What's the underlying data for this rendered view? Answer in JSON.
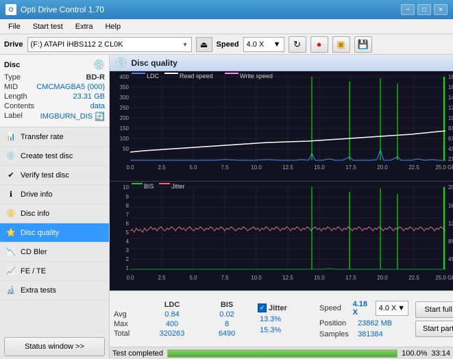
{
  "titleBar": {
    "title": "Opti Drive Control 1.70",
    "minimize": "−",
    "maximize": "□",
    "close": "×"
  },
  "menuBar": {
    "items": [
      "File",
      "Start test",
      "Extra",
      "Help"
    ]
  },
  "driveBar": {
    "label": "Drive",
    "driveValue": "(F:) ATAPI iHBS112  2 CL0K",
    "speedLabel": "Speed",
    "speedValue": "4.0 X"
  },
  "disc": {
    "sectionLabel": "Disc",
    "typeLabel": "Type",
    "typeValue": "BD-R",
    "midLabel": "MID",
    "midValue": "CMCMAGBA5 (000)",
    "lengthLabel": "Length",
    "lengthValue": "23.31 GB",
    "contentsLabel": "Contents",
    "contentsValue": "data",
    "labelLabel": "Label",
    "labelValue": "IMGBURN_DIS"
  },
  "nav": {
    "items": [
      {
        "id": "transfer-rate",
        "label": "Transfer rate",
        "icon": "📊"
      },
      {
        "id": "create-test-disc",
        "label": "Create test disc",
        "icon": "💿"
      },
      {
        "id": "verify-test-disc",
        "label": "Verify test disc",
        "icon": "✔"
      },
      {
        "id": "drive-info",
        "label": "Drive info",
        "icon": "ℹ"
      },
      {
        "id": "disc-info",
        "label": "Disc info",
        "icon": "📀"
      },
      {
        "id": "disc-quality",
        "label": "Disc quality",
        "icon": "⭐",
        "active": true
      },
      {
        "id": "cd-bler",
        "label": "CD Bler",
        "icon": "📉"
      },
      {
        "id": "fe-te",
        "label": "FE / TE",
        "icon": "📈"
      },
      {
        "id": "extra-tests",
        "label": "Extra tests",
        "icon": "🔬"
      }
    ],
    "statusButton": "Status window >>"
  },
  "discQuality": {
    "title": "Disc quality",
    "legend": {
      "ldc": {
        "label": "LDC",
        "color": "#0066ff"
      },
      "readSpeed": {
        "label": "Read speed",
        "color": "#ffffff"
      },
      "writeSpeed": {
        "label": "Write speed",
        "color": "#ff66ff"
      },
      "bis": {
        "label": "BIS",
        "color": "#00ff00"
      },
      "jitter": {
        "label": "Jitter",
        "color": "#ff6666"
      }
    }
  },
  "stats": {
    "headers": [
      "LDC",
      "BIS",
      "",
      "Jitter",
      "Speed",
      ""
    ],
    "avg": {
      "label": "Avg",
      "ldc": "0.84",
      "bis": "0.02",
      "jitter": "13.3%"
    },
    "max": {
      "label": "Max",
      "ldc": "400",
      "bis": "8",
      "jitter": "15.3%"
    },
    "total": {
      "label": "Total",
      "ldc": "320263",
      "bis": "6490"
    },
    "jitterChecked": true,
    "speed": {
      "value": "4.18 X",
      "select": "4.0 X"
    },
    "position": {
      "label": "Position",
      "value": "23862 MB"
    },
    "samples": {
      "label": "Samples",
      "value": "381384"
    },
    "startFull": "Start full",
    "startPart": "Start part"
  },
  "progressBar": {
    "status": "Test completed",
    "percent": 100,
    "time": "33:14"
  }
}
